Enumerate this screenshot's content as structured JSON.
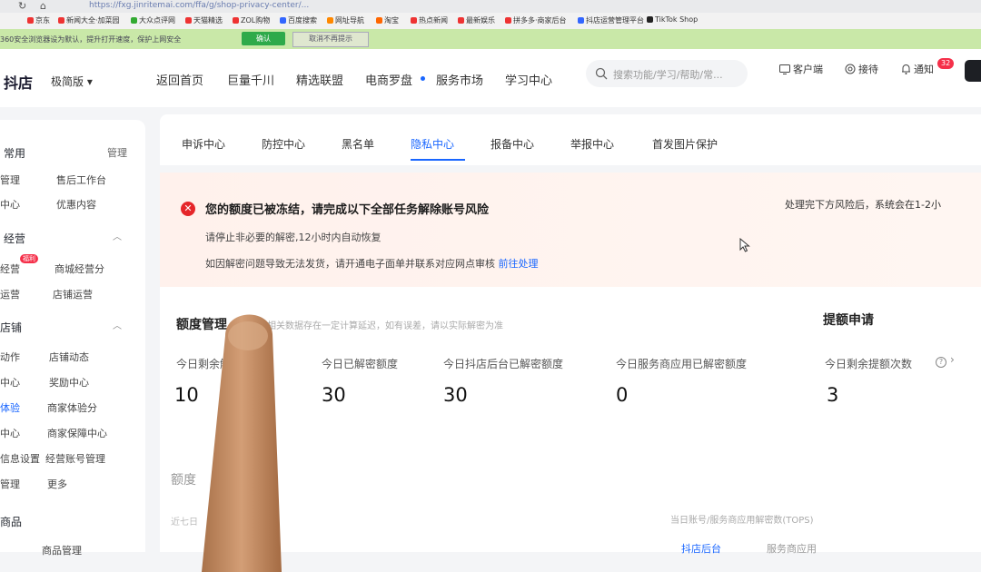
{
  "browser": {
    "url": "https://fxg.jinritemai.com/ffa/g/shop-privacy-center/...",
    "bookmarks": [
      "京东",
      "新闻大全·加菜园",
      "大众点评网",
      "天猫精选",
      "ZOL购物",
      "百度搜索",
      "网址导航",
      "淘宝",
      "热点新闻",
      "最新娱乐",
      "拼多多·商家后台",
      "抖店运营管理平台",
      "TikTok Shop"
    ]
  },
  "notice_bar": {
    "text": "360安全浏览器设为默认，提升打开速度，保护上网安全",
    "confirm_label": "确认",
    "dismiss_label": "取消不再提示"
  },
  "topnav": {
    "logo": "抖店",
    "edition": "极简版",
    "items": [
      "返回首页",
      "巨量千川",
      "精选联盟",
      "电商罗盘",
      "服务市场",
      "学习中心"
    ],
    "search_placeholder": "搜索功能/学习/帮助/常...",
    "tools": [
      "客户端",
      "接待",
      "通知"
    ],
    "notification_count": "32"
  },
  "sidebar": {
    "sections": [
      {
        "heading": "常用",
        "action": "管理",
        "items": [
          "管理",
          "售后工作台",
          "中心",
          "优惠内容"
        ]
      },
      {
        "heading": "经营",
        "items": [
          "经营",
          "商城经营分",
          "运营",
          "店铺运营"
        ],
        "tag": "福利"
      },
      {
        "heading": "店铺",
        "items": [
          "动作",
          "店铺动态",
          "中心",
          "奖励中心",
          "体验",
          "商家体验分",
          "中心",
          "商家保障中心",
          "信息设置",
          "经营账号管理",
          "管理",
          "更多"
        ]
      },
      {
        "heading": "商品",
        "items": [
          "商品管理"
        ]
      }
    ]
  },
  "tabs": {
    "items": [
      "申诉中心",
      "防控中心",
      "黑名单",
      "隐私中心",
      "报备中心",
      "举报中心",
      "首发图片保护"
    ],
    "active": "隐私中心"
  },
  "alert": {
    "title": "您的额度已被冻结，请完成以下全部任务解除账号风险",
    "line1": "请停止非必要的解密,12小时内自动恢复",
    "line2": "如因解密问题导致无法发货，请开通电子面单并联系对应网点审核",
    "link": "前往处理",
    "right_text": "处理完下方风险后，系统会在1-2小"
  },
  "quota": {
    "title": "额度管理",
    "note": "相关数据存在一定计算延迟，如有误差，请以实际解密为准",
    "raise_title": "提额申请",
    "metrics": [
      {
        "label": "今日剩余解密额度",
        "value": "10"
      },
      {
        "label": "今日已解密额度",
        "value": "30"
      },
      {
        "label": "今日抖店后台已解密额度",
        "value": "30"
      },
      {
        "label": "今日服务商应用已解密额度",
        "value": "0"
      },
      {
        "label": "今日剩余提额次数",
        "value": "3"
      }
    ]
  },
  "section2": {
    "title": "额度",
    "sub": "近七日",
    "right_text": "当日账号/服务商应用解密数(TOPS)",
    "seg_active": "抖店后台",
    "seg_other": "服务商应用"
  }
}
